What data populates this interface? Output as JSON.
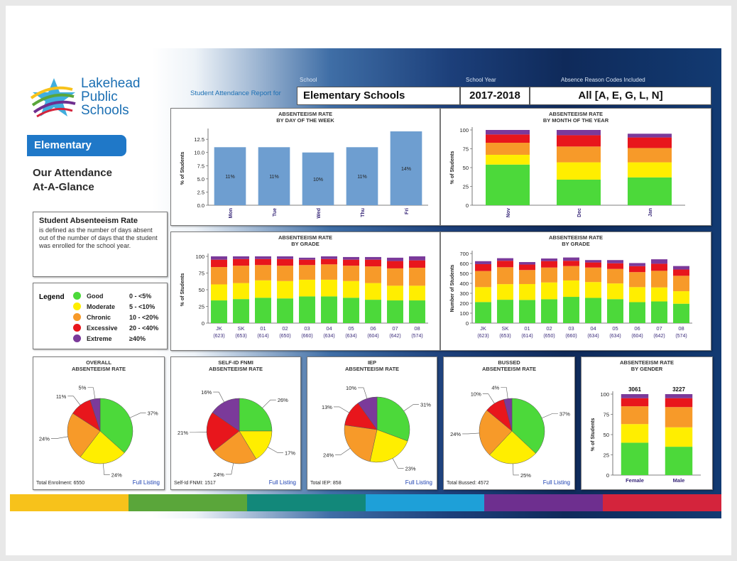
{
  "colors": {
    "good": "#4cd93a",
    "moderate": "#ffee00",
    "chronic": "#f79a29",
    "excessive": "#e8161c",
    "extreme": "#7b3a9a",
    "bar_blue": "#6e9ed0",
    "link": "#1a3fb0",
    "tab_blue": "#1f78c8"
  },
  "logo": {
    "line1": "Lakehead",
    "line2": "Public",
    "line3": "Schools"
  },
  "level_tab": "Elementary",
  "heading": {
    "line1": "Our Attendance",
    "line2": "At-A-Glance"
  },
  "definition": {
    "title": "Student Absenteeism Rate",
    "body": "is defined as the number of days absent out of the number of days that the student was enrolled for the school year."
  },
  "legend": {
    "title": "Legend",
    "items": [
      {
        "label": "Good",
        "range": "0 - <5%",
        "color": "#4cd93a"
      },
      {
        "label": "Moderate",
        "range": "5 - <10%",
        "color": "#ffee00"
      },
      {
        "label": "Chronic",
        "range": "10 - <20%",
        "color": "#f79a29"
      },
      {
        "label": "Excessive",
        "range": "20 - <40%",
        "color": "#e8161c"
      },
      {
        "label": "Extreme",
        "range": "≥40%",
        "color": "#7b3a9a"
      }
    ]
  },
  "header": {
    "report_label": "Student Attendance Report for",
    "school_label": "School",
    "school_value": "Elementary Schools",
    "year_label": "School Year",
    "year_value": "2017-2018",
    "codes_label": "Absence Reason Codes Included",
    "codes_value": "All  [A, E, G, L, N]"
  },
  "panels": {
    "overall": {
      "title1": "OVERALL",
      "title2": "ABSENTEEISM RATE",
      "footer": "Total Enrolment:  6550",
      "link": "Full Listing"
    },
    "fnmi": {
      "title1": "SELF-ID FNMI",
      "title2": "ABSENTEEISM RATE",
      "footer": "Self-Id FNMI:  1517",
      "link": "Full Listing"
    },
    "iep": {
      "title1": "IEP",
      "title2": "ABSENTEEISM RATE",
      "footer": "Total IEP:  858",
      "link": "Full Listing"
    },
    "bussed": {
      "title1": "BUSSED",
      "title2": "ABSENTEEISM RATE",
      "footer": "Total Bussed:  4572",
      "link": "Full Listing"
    }
  },
  "brand_colors": [
    "#f7c21b",
    "#5aa63a",
    "#12887a",
    "#1ea0d8",
    "#6e2f8f",
    "#d4243c"
  ],
  "chart_data": [
    {
      "id": "dow",
      "type": "bar",
      "title": "ABSENTEEISM RATE",
      "subtitle": "BY DAY OF THE WEEK",
      "ylabel": "% of Students",
      "categories": [
        "Mon",
        "Tue",
        "Wed",
        "Thu",
        "Fri"
      ],
      "values": [
        11,
        11,
        10,
        11,
        14
      ],
      "labels": [
        "11%",
        "11%",
        "10%",
        "11%",
        "14%"
      ],
      "ylim": [
        0,
        14
      ],
      "yticks": [
        "0.0",
        "2.5",
        "5.0",
        "7.5",
        "10.0",
        "12.5"
      ]
    },
    {
      "id": "month",
      "type": "bar",
      "stacked": true,
      "title": "ABSENTEEISM RATE",
      "subtitle": "BY MONTH OF THE YEAR",
      "ylabel": "% of Students",
      "categories": [
        "Nov",
        "Dec",
        "Jan"
      ],
      "ylim": [
        0,
        100
      ],
      "yticks": [
        "0",
        "25",
        "50",
        "75",
        "100"
      ],
      "series": [
        {
          "name": "Good",
          "values": [
            54,
            34,
            37
          ]
        },
        {
          "name": "Moderate",
          "values": [
            13,
            23,
            20
          ]
        },
        {
          "name": "Chronic",
          "values": [
            16,
            21,
            19
          ]
        },
        {
          "name": "Excessive",
          "values": [
            11,
            15,
            14
          ]
        },
        {
          "name": "Extreme",
          "values": [
            6,
            7,
            5
          ]
        }
      ]
    },
    {
      "id": "grade_pct",
      "type": "bar",
      "stacked": true,
      "title": "ABSENTEEISM RATE",
      "subtitle": "BY GRADE",
      "ylabel": "% of Students",
      "categories": [
        "JK",
        "SK",
        "01",
        "02",
        "03",
        "04",
        "05",
        "06",
        "07",
        "08"
      ],
      "sublabels": [
        "(623)",
        "(653)",
        "(614)",
        "(650)",
        "(660)",
        "(634)",
        "(634)",
        "(604)",
        "(642)",
        "(574)"
      ],
      "ylim": [
        0,
        100
      ],
      "yticks": [
        "0",
        "25",
        "50",
        "75",
        "100"
      ],
      "series": [
        {
          "name": "Good",
          "values": [
            34,
            36,
            38,
            37,
            40,
            40,
            38,
            35,
            34,
            34
          ]
        },
        {
          "name": "Moderate",
          "values": [
            24,
            24,
            26,
            26,
            25,
            25,
            25,
            25,
            22,
            22
          ]
        },
        {
          "name": "Chronic",
          "values": [
            26,
            26,
            23,
            23,
            22,
            23,
            23,
            25,
            26,
            27
          ]
        },
        {
          "name": "Excessive",
          "values": [
            11,
            10,
            9,
            10,
            8,
            8,
            9,
            10,
            11,
            11
          ]
        },
        {
          "name": "Extreme",
          "values": [
            5,
            4,
            4,
            4,
            3,
            4,
            4,
            4,
            5,
            6
          ]
        }
      ]
    },
    {
      "id": "grade_num",
      "type": "bar",
      "stacked": true,
      "title": "ABSENTEEISM RATE",
      "subtitle": "BY GRADE",
      "ylabel": "Number of Students",
      "categories": [
        "JK",
        "SK",
        "01",
        "02",
        "03",
        "04",
        "05",
        "06",
        "07",
        "08"
      ],
      "sublabels": [
        "(623)",
        "(653)",
        "(614)",
        "(650)",
        "(660)",
        "(634)",
        "(634)",
        "(604)",
        "(642)",
        "(574)"
      ],
      "ylim": [
        0,
        700
      ],
      "yticks": [
        "0",
        "100",
        "200",
        "300",
        "400",
        "500",
        "600",
        "700"
      ],
      "series": [
        {
          "name": "Good",
          "values": [
            212,
            235,
            233,
            240,
            264,
            254,
            241,
            211,
            218,
            195
          ]
        },
        {
          "name": "Moderate",
          "values": [
            150,
            157,
            160,
            169,
            165,
            159,
            158,
            151,
            141,
            126
          ]
        },
        {
          "name": "Chronic",
          "values": [
            162,
            170,
            141,
            150,
            145,
            146,
            146,
            151,
            167,
            155
          ]
        },
        {
          "name": "Excessive",
          "values": [
            69,
            65,
            55,
            65,
            53,
            51,
            57,
            60,
            71,
            63
          ]
        },
        {
          "name": "Extreme",
          "values": [
            30,
            26,
            25,
            26,
            33,
            24,
            32,
            31,
            45,
            35
          ]
        }
      ]
    },
    {
      "id": "overall",
      "type": "pie",
      "values": [
        37,
        24,
        24,
        11,
        5
      ],
      "labels": [
        "37%",
        "24%",
        "24%",
        "11%",
        "5%"
      ]
    },
    {
      "id": "fnmi",
      "type": "pie",
      "values": [
        26,
        17,
        24,
        21,
        16
      ],
      "labels": [
        "26%",
        "17%",
        "24%",
        "21%",
        "16%"
      ]
    },
    {
      "id": "iep",
      "type": "pie",
      "values": [
        31,
        23,
        24,
        13,
        10
      ],
      "labels": [
        "31%",
        "23%",
        "24%",
        "13%",
        "10%"
      ]
    },
    {
      "id": "bussed",
      "type": "pie",
      "values": [
        37,
        25,
        24,
        10,
        4
      ],
      "labels": [
        "37%",
        "25%",
        "24%",
        "10%",
        "4%"
      ]
    },
    {
      "id": "gender",
      "type": "bar",
      "stacked": true,
      "title": "ABSENTEEISM RATE",
      "subtitle": "BY GENDER",
      "ylabel": "% of Students",
      "categories": [
        "Female",
        "Male"
      ],
      "totals": [
        "3061",
        "3227"
      ],
      "ylim": [
        0,
        100
      ],
      "yticks": [
        "0",
        "25",
        "50",
        "75",
        "100"
      ],
      "series": [
        {
          "name": "Good",
          "values": [
            40,
            35
          ]
        },
        {
          "name": "Moderate",
          "values": [
            23,
            24
          ]
        },
        {
          "name": "Chronic",
          "values": [
            22,
            25
          ]
        },
        {
          "name": "Excessive",
          "values": [
            10,
            11
          ]
        },
        {
          "name": "Extreme",
          "values": [
            5,
            5
          ]
        }
      ]
    }
  ]
}
